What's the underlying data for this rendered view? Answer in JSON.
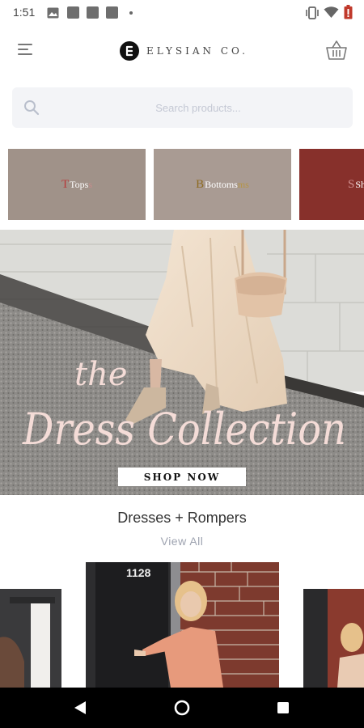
{
  "status_bar": {
    "time": "1:51",
    "left_icons": [
      "image-icon",
      "notification-icon",
      "notification-icon",
      "notification-icon",
      "more-dot-icon"
    ],
    "right_icons": [
      "vibrate-icon",
      "wifi-icon",
      "battery-icon"
    ],
    "battery_color": "#c0392b"
  },
  "header": {
    "menu_icon": "hamburger-menu-icon",
    "brand": "ELYSIAN CO.",
    "cart_icon": "shopping-basket-icon"
  },
  "search": {
    "placeholder": "Search products...",
    "value": ""
  },
  "categories": [
    {
      "initial": "T",
      "label": "Tops",
      "trail": "s",
      "color": "#a09289"
    },
    {
      "initial": "B",
      "label": "Bottoms",
      "trail": "ms",
      "color": "#a99b93"
    },
    {
      "initial": "S",
      "label": "Sho",
      "trail": "",
      "color": "#87302b"
    }
  ],
  "hero": {
    "line1": "the",
    "line2": "Dress Collection",
    "cta": "SHOP NOW"
  },
  "section": {
    "title": "Dresses + Rompers",
    "view_all": "View All"
  },
  "product_sign": "1128",
  "nav_bar": {
    "back_icon": "back-triangle-icon",
    "home_icon": "home-circle-icon",
    "recents_icon": "recents-square-icon"
  }
}
